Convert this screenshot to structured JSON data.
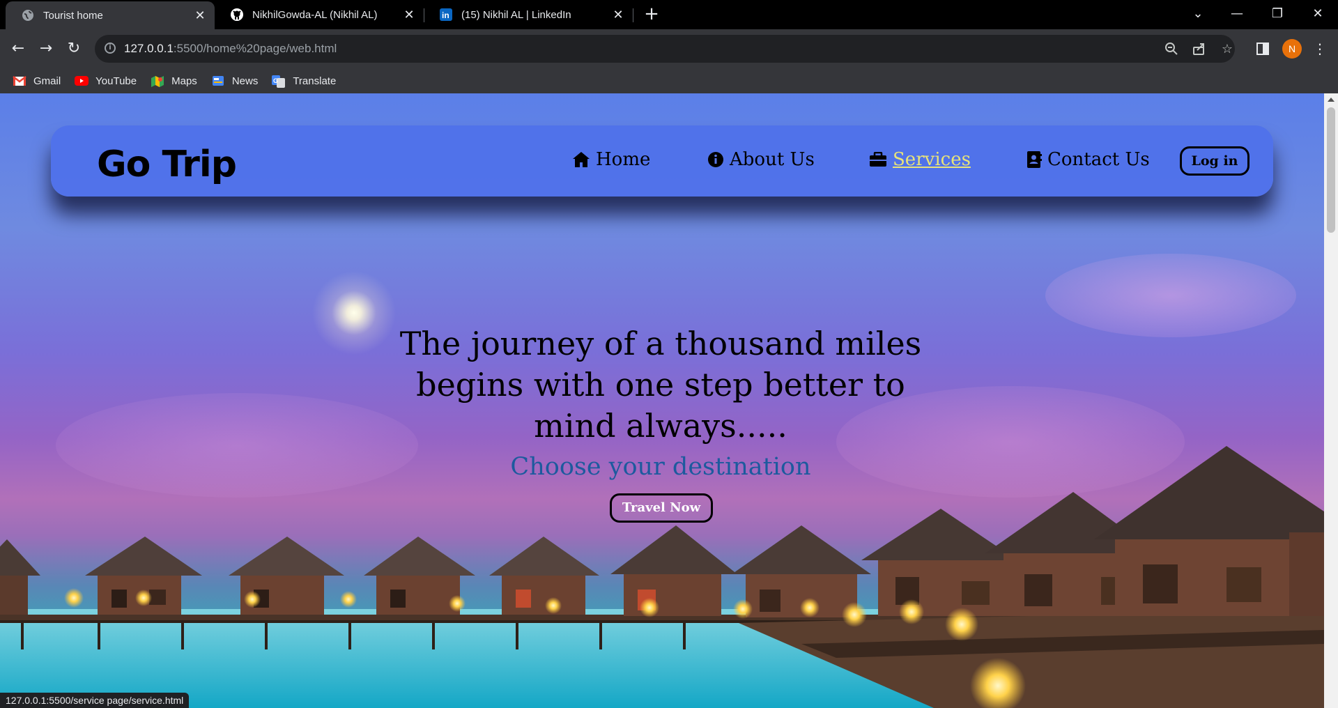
{
  "browser": {
    "tabs": [
      {
        "title": "Tourist home",
        "active": true
      },
      {
        "title": "NikhilGowda-AL (Nikhil AL)",
        "active": false
      },
      {
        "title": "(15) Nikhil AL | LinkedIn",
        "active": false
      }
    ],
    "url": {
      "host": "127.0.0.1",
      "path": ":5500/home%20page/web.html"
    },
    "bookmarks": [
      {
        "label": "Gmail",
        "icon": "gmail-icon"
      },
      {
        "label": "YouTube",
        "icon": "youtube-icon"
      },
      {
        "label": "Maps",
        "icon": "maps-icon"
      },
      {
        "label": "News",
        "icon": "news-icon"
      },
      {
        "label": "Translate",
        "icon": "translate-icon"
      }
    ],
    "profile_initial": "N",
    "status_url": "127.0.0.1:5500/service page/service.html"
  },
  "page": {
    "logo": "Go Trip",
    "nav": [
      {
        "label": "Home",
        "icon": "home-icon"
      },
      {
        "label": "About Us",
        "icon": "info-icon"
      },
      {
        "label": "Services",
        "icon": "briefcase-icon",
        "hovered": true
      },
      {
        "label": "Contact Us",
        "icon": "contact-book-icon"
      }
    ],
    "login_label": "Log in",
    "headline": "The journey of a thousand miles begins with one step better to mind always.....",
    "subheadline": "Choose your destination",
    "cta_label": "Travel Now"
  },
  "colors": {
    "nav_bg": "#4d70eb",
    "nav_hover": "#e8e37a",
    "subhead": "#1d5a9e",
    "profile": "#e8710a"
  }
}
